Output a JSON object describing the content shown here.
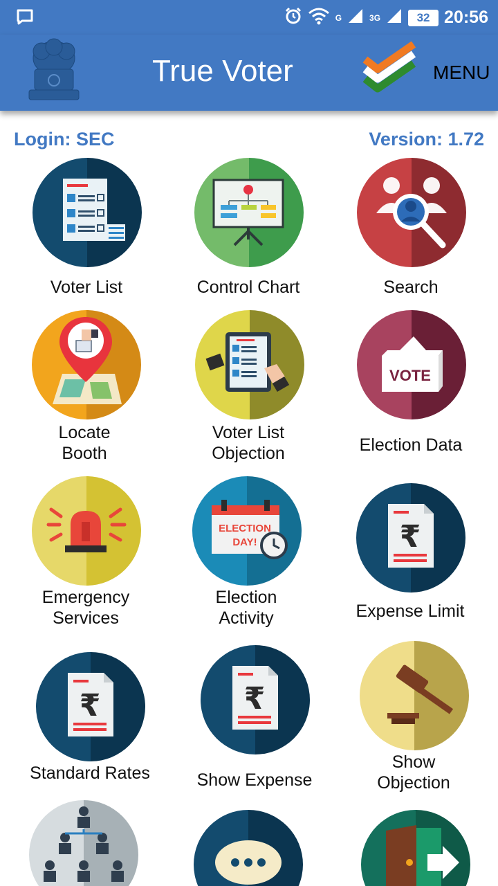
{
  "status_bar": {
    "time": "20:56",
    "battery": "32",
    "network_a": "G",
    "network_b": "3G",
    "icons": [
      "chat-notification-icon",
      "alarm-icon",
      "wifi-icon",
      "signal-icon",
      "signal-icon",
      "battery-icon"
    ]
  },
  "app_bar": {
    "title": "True Voter",
    "menu_label": "MENU",
    "emblem_icon": "ashoka-emblem-icon",
    "logo_icon": "tricolor-check-icon"
  },
  "info": {
    "login": "Login: SEC",
    "version": "Version: 1.72"
  },
  "tiles": [
    {
      "label": "Voter List",
      "icon": "voter-list-icon"
    },
    {
      "label": "Control Chart",
      "icon": "control-chart-icon"
    },
    {
      "label": "Search",
      "icon": "search-people-icon"
    },
    {
      "label": "Locate\nBooth",
      "icon": "locate-booth-icon"
    },
    {
      "label": "Voter List\nObjection",
      "icon": "voter-list-objection-icon"
    },
    {
      "label": "Election Data",
      "icon": "ballot-box-icon",
      "icon_text": "VOTE"
    },
    {
      "label": "Emergency\nServices",
      "icon": "emergency-siren-icon"
    },
    {
      "label": "Election\nActivity",
      "icon": "election-day-calendar-icon",
      "icon_text_1": "ELECTION",
      "icon_text_2": "DAY!"
    },
    {
      "label": "Expense Limit",
      "icon": "rupee-document-icon"
    },
    {
      "label": "Standard Rates",
      "icon": "rupee-document-icon"
    },
    {
      "label": "Show Expense",
      "icon": "rupee-document-icon"
    },
    {
      "label": "Show\nObjection",
      "icon": "gavel-icon"
    },
    {
      "label": "",
      "icon": "hierarchy-people-icon"
    },
    {
      "label": "",
      "icon": "chat-bubble-icon"
    },
    {
      "label": "",
      "icon": "exit-door-icon"
    }
  ],
  "colors": {
    "primary": "#4279c3",
    "navy": "#134b6e",
    "green": "#3e9c4c",
    "red": "#b63437",
    "orange": "#f0a21e",
    "olive": "#9e9a2c",
    "maroon": "#8c2e4c",
    "yellow": "#e2ce45",
    "teal": "#1b8bb7",
    "sand": "#e8cf6d",
    "grey": "#b7c0c4",
    "darkgreen": "#14705c"
  }
}
